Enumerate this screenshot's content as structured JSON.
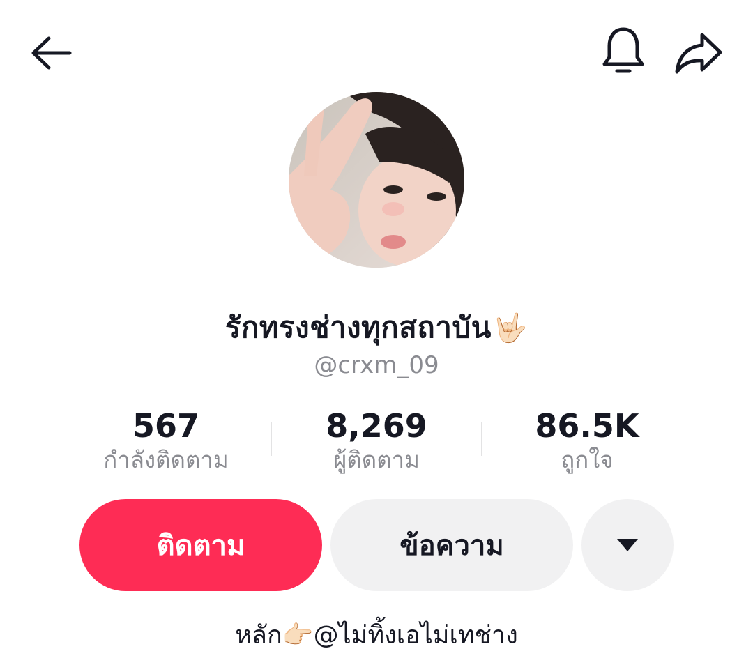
{
  "header": {
    "back_icon": "arrow-left-icon",
    "bell_icon": "bell-icon",
    "share_icon": "share-arrow-icon"
  },
  "profile": {
    "display_name": "รักทรงช่างทุกสถาบัน",
    "display_name_emoji": "🤟🏻",
    "username": "@crxm_09",
    "bio_prefix": "หลัก",
    "bio_emoji": "👉🏻",
    "bio_suffix": "@ไม่ทิ้งเอไม่เทช่าง"
  },
  "stats": [
    {
      "value": "567",
      "label": "กำลังติดตาม"
    },
    {
      "value": "8,269",
      "label": "ผู้ติดตาม"
    },
    {
      "value": "86.5K",
      "label": "ถูกใจ"
    }
  ],
  "actions": {
    "follow_label": "ติดตาม",
    "message_label": "ข้อความ",
    "more_icon": "caret-down-icon"
  },
  "colors": {
    "accent": "#fe2c55",
    "secondary_bg": "#f1f1f2",
    "muted_text": "#8a8b91",
    "primary_text": "#161823"
  }
}
